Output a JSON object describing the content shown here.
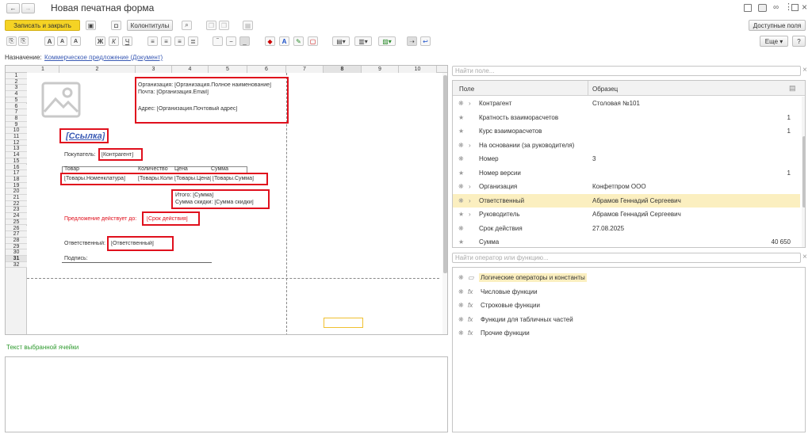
{
  "window": {
    "title": "Новая печатная форма",
    "back_label": "←",
    "forward_label": "→",
    "controls": [
      "doc-icon",
      "print-icon",
      "link-icon",
      "more-icon",
      "maximize-icon",
      "close-icon"
    ]
  },
  "toolbar": {
    "save_close_label": "Записать и закрыть",
    "headers_footers_label": "Колонтитулы",
    "available_fields_label": "Доступные поля",
    "more_label": "Еще",
    "accent": "#f5d324"
  },
  "format_bar": {
    "bold": "Ж",
    "italic": "К",
    "underline": "Ч",
    "font_a": "A",
    "font_grow": "A",
    "font_shrink": "A"
  },
  "purpose": {
    "label": "Назначение:",
    "link": "Коммерческое предложение (Документ)"
  },
  "sheet": {
    "columns": [
      "1",
      "2",
      "3",
      "4",
      "5",
      "6",
      "7",
      "8",
      "9",
      "10"
    ],
    "rows": [
      "1",
      "2",
      "3",
      "4",
      "5",
      "6",
      "7",
      "8",
      "9",
      "10",
      "11",
      "12",
      "13",
      "14",
      "15",
      "16",
      "17",
      "18",
      "19",
      "20",
      "21",
      "22",
      "23",
      "24",
      "25",
      "26",
      "27",
      "28",
      "29",
      "30",
      "31",
      "32"
    ],
    "cells": {
      "org_name": "Организация: [Организация.Полное наименование]",
      "org_email": "Почта: [Организация.Email]",
      "org_address": "Адрес: [Организация.Почтовый адрес]",
      "link": "[Ссылка]",
      "buyer_label": "Покупатель:",
      "buyer_value": "[Контрагент]",
      "col_goods": "Товар",
      "col_qty": "Количество",
      "col_price": "Цена",
      "col_sum": "Сумма",
      "val_goods": "[Товары.Номенклатура]",
      "val_qty": "[Товары.Количество]",
      "val_price": "[Товары.Цена]",
      "val_sum": "[Товары.Сумма]",
      "total": "Итого: [Сумма]",
      "total_discount": "Сумма скидки: [Сумма скидки]",
      "offer_label": "Предложение действует до:",
      "offer_value": "[Срок действия]",
      "resp_label": "Ответственный:",
      "resp_value": "[Ответственный]",
      "sign": "Подпись:"
    }
  },
  "cell_text_label": "Текст выбранной ячейки",
  "fields_panel": {
    "search_placeholder": "Найти поле...",
    "col_field": "Поле",
    "col_sample": "Образец",
    "rows": [
      {
        "name": "Контрагент",
        "sample": "Столовая №101",
        "num": "",
        "expand": true,
        "tag": "❋",
        "highlight": false
      },
      {
        "name": "Кратность взаиморасчетов",
        "sample": "",
        "num": "1",
        "expand": false,
        "tag": "★",
        "highlight": false
      },
      {
        "name": "Курс взаиморасчетов",
        "sample": "",
        "num": "1",
        "expand": false,
        "tag": "★",
        "highlight": false
      },
      {
        "name": "На основании (за руководителя)",
        "sample": "",
        "num": "",
        "expand": true,
        "tag": "❋",
        "highlight": false
      },
      {
        "name": "Номер",
        "sample": "3",
        "num": "",
        "expand": false,
        "tag": "❋",
        "highlight": false
      },
      {
        "name": "Номер версии",
        "sample": "",
        "num": "1",
        "expand": false,
        "tag": "★",
        "highlight": false
      },
      {
        "name": "Организация",
        "sample": "Конфетпром ООО",
        "num": "",
        "expand": true,
        "tag": "❋",
        "highlight": false
      },
      {
        "name": "Ответственный",
        "sample": "Абрамов Геннадий Сергеевич",
        "num": "",
        "expand": true,
        "tag": "❋",
        "highlight": true
      },
      {
        "name": "Руководитель",
        "sample": "Абрамов Геннадий Сергеевич",
        "num": "",
        "expand": true,
        "tag": "★",
        "highlight": false
      },
      {
        "name": "Срок действия",
        "sample": "27.08.2025",
        "num": "",
        "expand": false,
        "tag": "❋",
        "highlight": false
      },
      {
        "name": "Сумма",
        "sample": "",
        "num": "40 650",
        "expand": false,
        "tag": "★",
        "highlight": false
      }
    ],
    "highlight_color": "#fbefc0"
  },
  "functions_panel": {
    "search_placeholder": "Найти оператор или функцию...",
    "items": [
      {
        "label": "Логические операторы и константы",
        "icon": "folder",
        "highlight": true
      },
      {
        "label": "Числовые функции",
        "icon": "fx",
        "highlight": false
      },
      {
        "label": "Строковые функции",
        "icon": "fx",
        "highlight": false
      },
      {
        "label": "Функции для табличных частей",
        "icon": "fx",
        "highlight": false
      },
      {
        "label": "Прочие функции",
        "icon": "fx",
        "highlight": false
      }
    ]
  },
  "colors": {
    "link": "#3b5bb5",
    "red": "#e0101d",
    "offer_text": "#e0101d",
    "green_label": "#2e9a2e"
  }
}
